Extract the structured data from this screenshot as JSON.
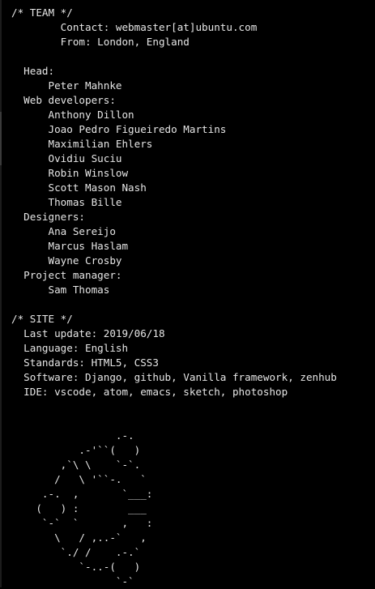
{
  "theme": {
    "background": "#000000",
    "text_color": "#e6e6e6"
  },
  "team": {
    "header": "/* TEAM */",
    "contact": "        Contact: webmaster[at]ubuntu.com",
    "from": "        From: London, England",
    "head_label": "  Head:",
    "head_members": [
      "      Peter Mahnke"
    ],
    "webdev_label": "  Web developers:",
    "webdev_members": [
      "      Anthony Dillon",
      "      Joao Pedro Figueiredo Martins",
      "      Maximilian Ehlers",
      "      Ovidiu Suciu",
      "      Robin Winslow",
      "      Scott Mason Nash",
      "      Thomas Bille"
    ],
    "designers_label": "  Designers:",
    "designers_members": [
      "      Ana Sereijo",
      "      Marcus Haslam",
      "      Wayne Crosby"
    ],
    "pm_label": "  Project manager:",
    "pm_members": [
      "      Sam Thomas"
    ]
  },
  "site": {
    "header": "/* SITE */",
    "last_update": "  Last update: 2019/06/18",
    "language": "  Language: English",
    "standards": "  Standards: HTML5, CSS3",
    "software": "  Software: Django, github, Vanilla framework, zenhub",
    "ide": "  IDE: vscode, atom, emacs, sketch, photoshop"
  },
  "ascii_logo": [
    "                 .-.",
    "           .-'``(   )",
    "        ,`\\ \\    `-`.",
    "       /   \\ '``-.   `",
    "     .-.  ,       `___:",
    "    (   ) :        ___",
    "     `-`  `       ,   :",
    "       \\   / ,..-`   ,",
    "        `./ /    .-.`",
    "           `-..-(   )",
    "                 `-`"
  ]
}
